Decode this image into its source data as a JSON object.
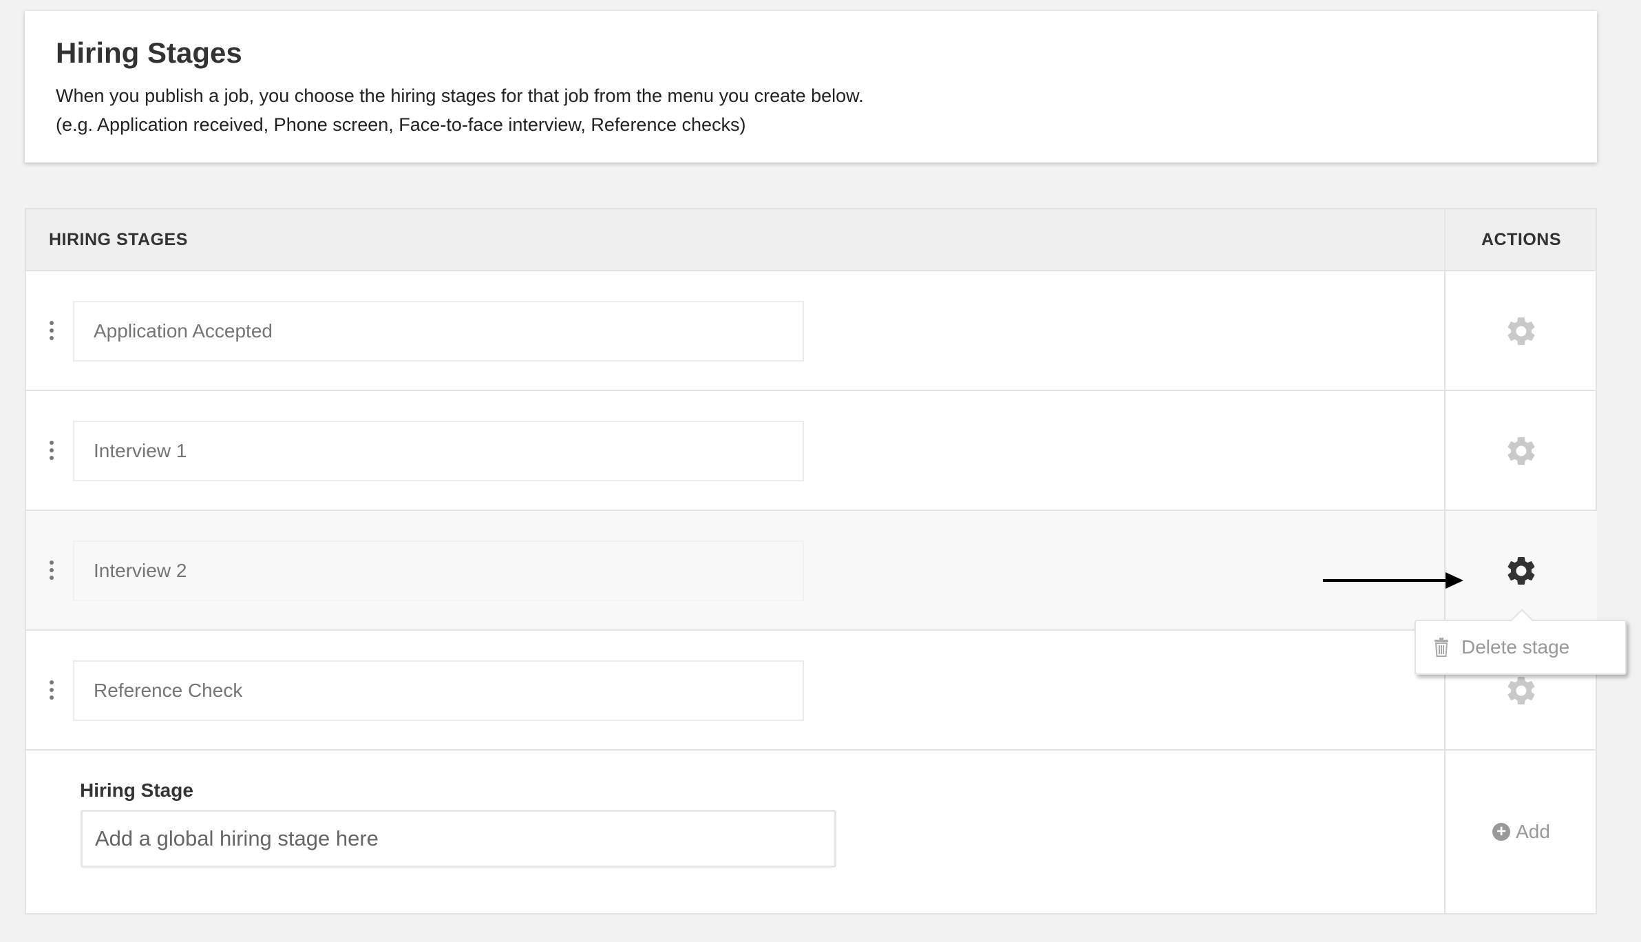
{
  "header": {
    "title": "Hiring Stages",
    "description_line1": "When you publish a job, you choose the hiring stages for that job from the menu you create below.",
    "description_line2": "(e.g. Application received, Phone screen, Face-to-face interview, Reference checks)"
  },
  "table": {
    "columns": [
      "HIRING STAGES",
      "ACTIONS"
    ],
    "rows": [
      {
        "placeholder": "Application Accepted"
      },
      {
        "placeholder": "Interview 1"
      },
      {
        "placeholder": "Interview 2"
      },
      {
        "placeholder": "Reference Check"
      }
    ]
  },
  "add_stage": {
    "label": "Hiring Stage",
    "placeholder": "Add a global hiring stage here",
    "button_label": "Add"
  },
  "popover": {
    "item_label": "Delete stage"
  },
  "icons": {
    "row_handle": "drag-handle-icon",
    "actions": "gear-icon",
    "delete": "trash-icon",
    "add": "plus-circle-icon",
    "annotation": "arrow-icon"
  },
  "colors": {
    "gear_inactive": "#c9c9c9",
    "gear_active": "#333333",
    "background": "#f2f2f2"
  }
}
